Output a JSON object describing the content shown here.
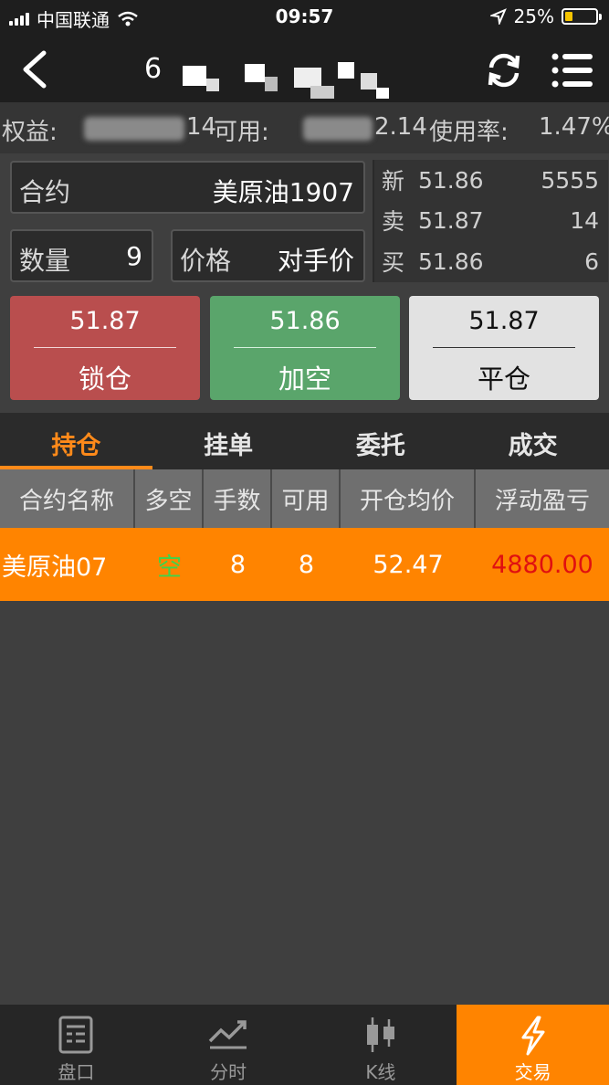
{
  "status_bar": {
    "carrier": "中国联通",
    "time": "09:57",
    "battery": "25%",
    "battery_level": 0.25
  },
  "nav": {
    "title": "6"
  },
  "equity": {
    "equity_label": "权益:",
    "equity_tail": "14",
    "available_label": "可用:",
    "available_tail": "2.14",
    "usage_label": "使用率:",
    "usage_value": "1.47%"
  },
  "order": {
    "contract_label": "合约",
    "contract_value": "美原油1907",
    "qty_label": "数量",
    "qty_value": "9",
    "price_label": "价格",
    "price_value": "对手价"
  },
  "quotes": [
    {
      "tag": "新",
      "price": "51.86",
      "volume": "5555"
    },
    {
      "tag": "卖",
      "price": "51.87",
      "volume": "14"
    },
    {
      "tag": "买",
      "price": "51.86",
      "volume": "6"
    }
  ],
  "actions": {
    "lock": {
      "price": "51.87",
      "label": "锁仓"
    },
    "add": {
      "price": "51.86",
      "label": "加空"
    },
    "flat": {
      "price": "51.87",
      "label": "平仓"
    }
  },
  "tabs": [
    "持仓",
    "挂单",
    "委托",
    "成交"
  ],
  "table": {
    "headers": [
      "合约名称",
      "多空",
      "手数",
      "可用",
      "开仓均价",
      "浮动盈亏"
    ],
    "rows": [
      {
        "name": "美原油07",
        "direction": "空",
        "lots": "8",
        "available": "8",
        "avg_price": "52.47",
        "pnl": "4880.00"
      }
    ]
  },
  "bottom_tabs": [
    "盘口",
    "分时",
    "K线",
    "交易"
  ],
  "colors": {
    "accent": "#ff8400",
    "lock": "#b94e4e",
    "add": "#5aa56b",
    "flat": "#e2e2e2",
    "pnl": "#e01010",
    "short": "#3fd44a"
  }
}
